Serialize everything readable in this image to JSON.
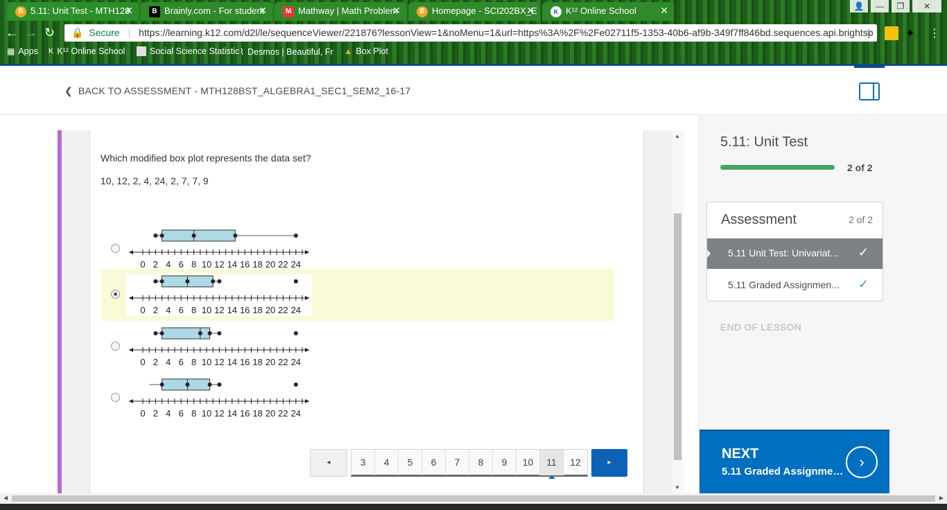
{
  "browser": {
    "tabs": [
      {
        "title": "5.11: Unit Test - MTH128",
        "icon": "brainly-b-icon",
        "active": true
      },
      {
        "title": "Brainly.com - For student",
        "icon": "brainly-icon"
      },
      {
        "title": "Mathway | Math Problem",
        "icon": "mathway-icon"
      },
      {
        "title": "Homepage - SCI202BX_E",
        "icon": "brainly-b-icon"
      },
      {
        "title": "K¹² Online School",
        "icon": "k12-icon"
      }
    ],
    "secure_label": "Secure",
    "url": "https://learning.k12.com/d2l/le/sequenceViewer/221876?lessonView=1&noMenu=1&url=https%3A%2F%2Fe02711f5-1353-40b6-af9b-349f7ff846bd.sequences.api.brightsp",
    "bookmarks": [
      {
        "label": "Apps"
      },
      {
        "label": "K¹² Online School"
      },
      {
        "label": "Social Science Statistic"
      },
      {
        "label": "Desmos | Beautiful, Fr"
      },
      {
        "label": "Box Plot"
      }
    ]
  },
  "header": {
    "back_label": "BACK TO ASSESSMENT - MTH128BST_ALGEBRA1_SEC1_SEM2_16-17"
  },
  "question": {
    "prompt": "Which modified box plot represents the data set?",
    "dataset": "10, 12, 2, 4, 24, 2, 7, 7, 9",
    "axis_ticks": [
      "0",
      "2",
      "4",
      "6",
      "8",
      "10",
      "12",
      "14",
      "16",
      "18",
      "20",
      "22",
      "24"
    ],
    "options": [
      {
        "selected": false,
        "whisker_min": 2,
        "q1": 3,
        "median": 8,
        "q3": 14.5,
        "whisker_max": 24,
        "dots": [
          2,
          3,
          8,
          14.5,
          24
        ]
      },
      {
        "selected": true,
        "whisker_min": 2,
        "q1": 3,
        "median": 7,
        "q3": 11,
        "whisker_max": 12,
        "dots": [
          2,
          3,
          7,
          11,
          12,
          24
        ]
      },
      {
        "selected": false,
        "whisker_min": 2,
        "q1": 3,
        "median": 9,
        "q3": 10.5,
        "whisker_max": 12,
        "dots": [
          2,
          3,
          9,
          10.5,
          12,
          24
        ]
      },
      {
        "selected": false,
        "whisker_min": 1,
        "q1": 3,
        "median": 7,
        "q3": 10.5,
        "whisker_max": 12,
        "dots": [
          3,
          7,
          10.5,
          12,
          24
        ]
      }
    ]
  },
  "pager": {
    "pages": [
      "3",
      "4",
      "5",
      "6",
      "7",
      "8",
      "9",
      "10",
      "11",
      "12"
    ],
    "current": "11",
    "prev_glyph": "◂",
    "next_glyph": "▸"
  },
  "sidebar": {
    "title": "5.11: Unit Test",
    "progress_text": "2 of 2",
    "card_title": "Assessment",
    "card_count": "2 of 2",
    "items": [
      {
        "label": "5.11 Unit Test: Univariat...",
        "active": true
      },
      {
        "label": "5.11 Graded Assignmen...",
        "active": false
      }
    ],
    "end_label": "END OF LESSON",
    "next_label": "NEXT",
    "next_target": "5.11 Graded Assignmen..."
  },
  "colors": {
    "accent_purple": "#b86ad0",
    "box_fill": "#add8e6",
    "progress_green": "#46a661",
    "next_blue": "#006fbf"
  }
}
